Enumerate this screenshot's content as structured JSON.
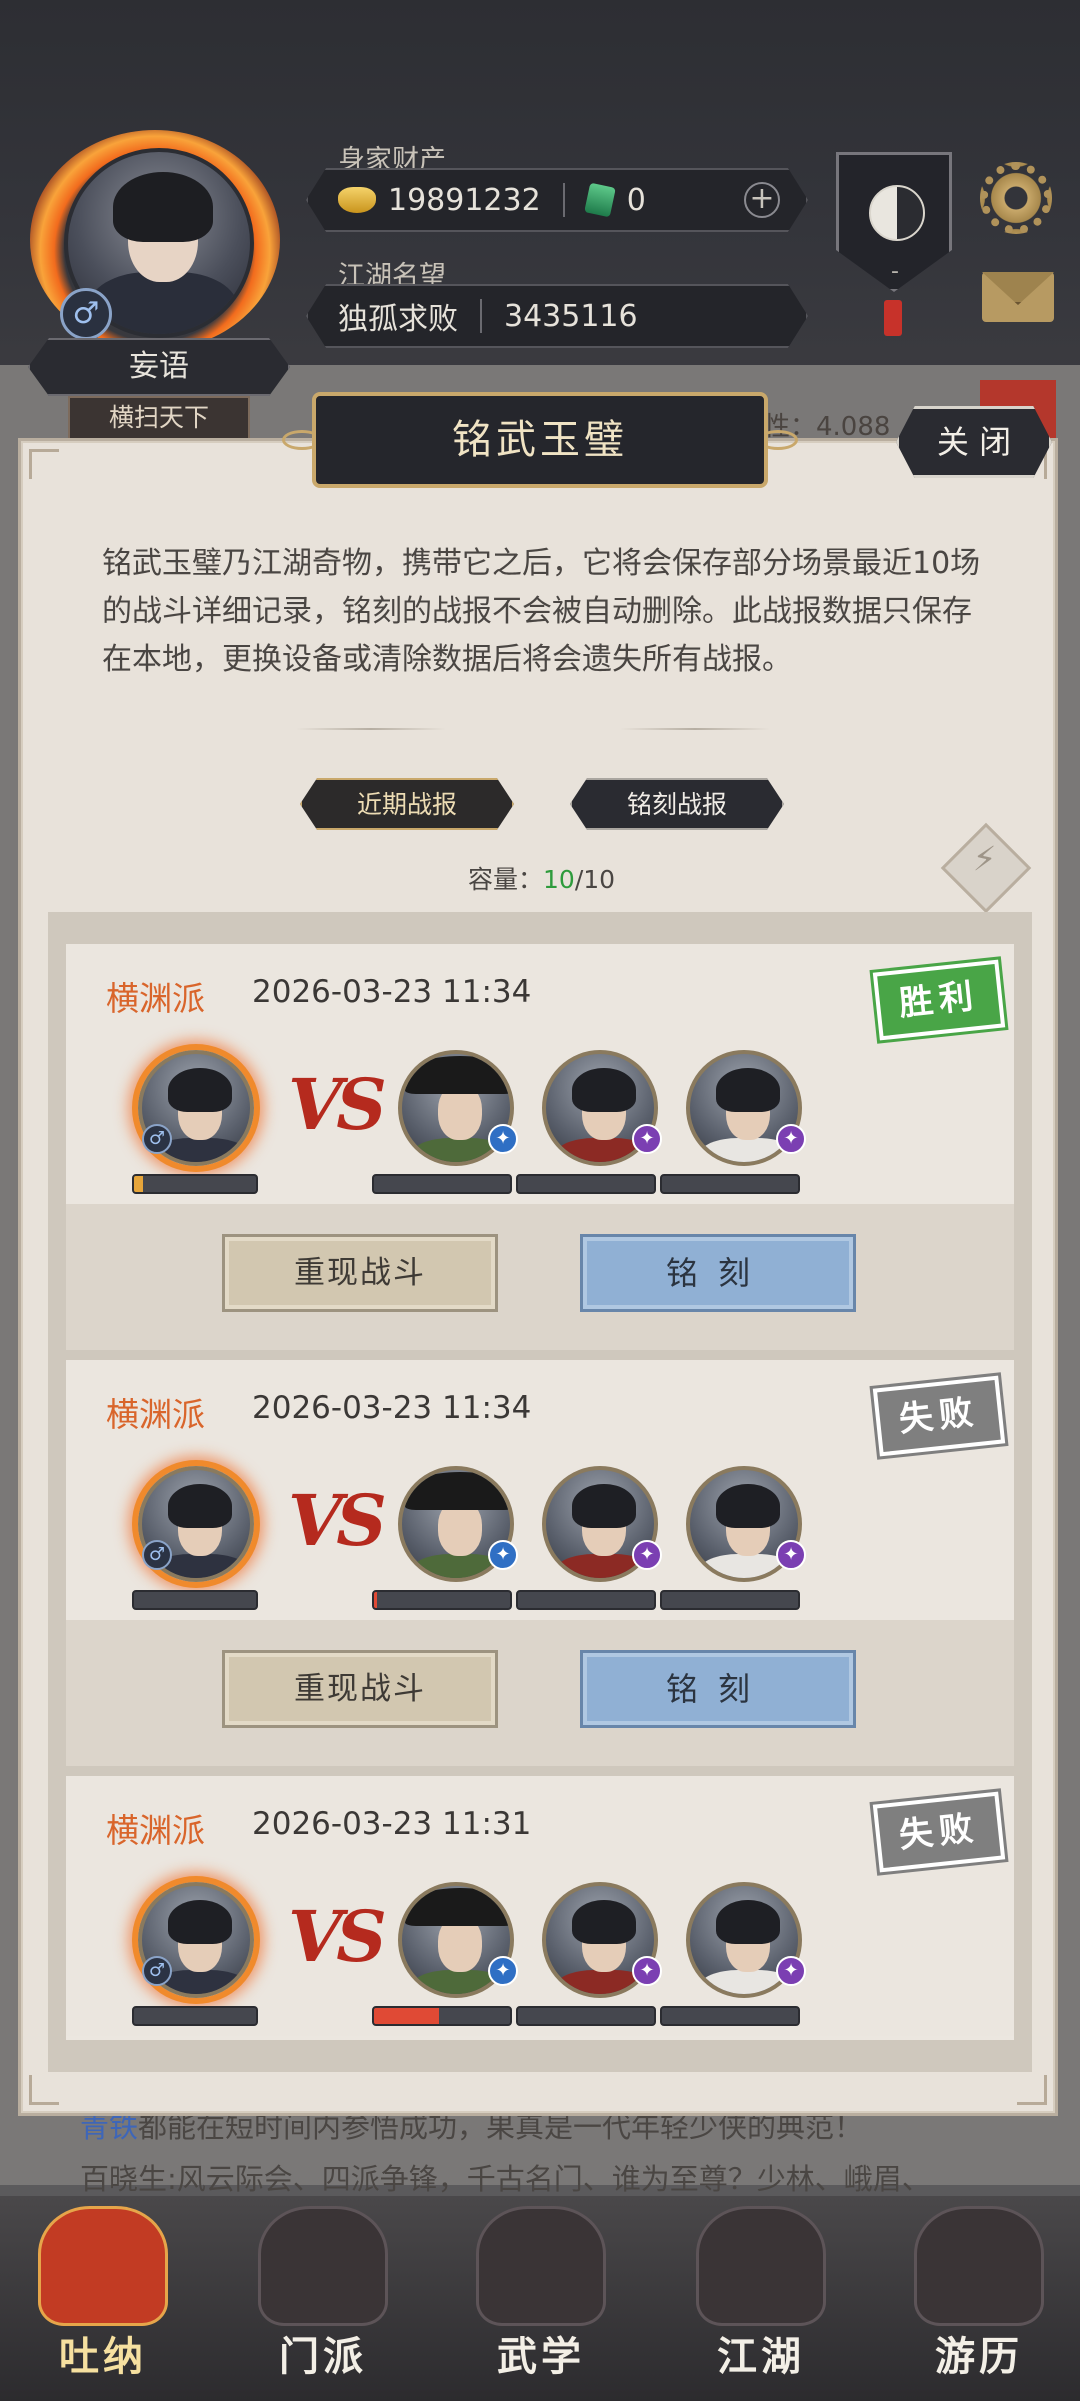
{
  "header": {
    "player_name": "妄语",
    "player_title": "横扫天下",
    "gender_symbol": "♂",
    "wealth_label": "身家财产",
    "gold": "19891232",
    "jade": "0",
    "plus": "+",
    "reputation_label": "江湖名望",
    "rank_name": "独孤求败",
    "reputation_value": "3435116",
    "taiji_dash": "-",
    "attr_text": "性：4.088"
  },
  "modal": {
    "title": "铭武玉璧",
    "close_label": "关 闭",
    "description": "铭武玉璧乃江湖奇物，携带它之后，它将会保存部分场景最近10场的战斗详细记录，铭刻的战报不会被自动删除。此战报数据只保存在本地，更换设备或清除数据后将会遗失所有战报。",
    "tabs": [
      {
        "label": "近期战报"
      },
      {
        "label": "铭刻战报"
      }
    ],
    "capacity_label": "容量：",
    "capacity_used": "10",
    "capacity_total": "/10",
    "refresh_glyph": "⚡"
  },
  "records": [
    {
      "sect": "横渊派",
      "time": "2026-03-23 11:34",
      "result": "胜利",
      "vs": "VS",
      "player_hp": 0.07,
      "enemy_hp": [
        0,
        0,
        0
      ],
      "replay_label": "重现战斗",
      "engrave_label": "铭刻"
    },
    {
      "sect": "横渊派",
      "time": "2026-03-23 11:34",
      "result": "失败",
      "vs": "VS",
      "player_hp": 0,
      "enemy_hp": [
        0.02,
        0,
        0
      ],
      "replay_label": "重现战斗",
      "engrave_label": "铭刻"
    },
    {
      "sect": "横渊派",
      "time": "2026-03-23 11:31",
      "result": "失败",
      "vs": "VS",
      "player_hp": 0,
      "enemy_hp": [
        0.48,
        0,
        0
      ],
      "replay_label": "重现战斗",
      "engrave_label": "铭刻"
    }
  ],
  "chat": {
    "line1_prefix": "青铁",
    "line1_text": "都能在短时间内参悟成功，果真是一代年轻少侠的典范！",
    "line2": "百晓生:风云际会、四派争锋，千古名门、谁为至尊？少林、峨眉、"
  },
  "nav": [
    {
      "label": "吐纳",
      "icon": "gourd-icon"
    },
    {
      "label": "门派",
      "icon": "banner-icon"
    },
    {
      "label": "武学",
      "icon": "book-icon"
    },
    {
      "label": "江湖",
      "icon": "hat-icon"
    },
    {
      "label": "游历",
      "icon": "horse-icon"
    }
  ],
  "colors": {
    "win": "#49a547",
    "lose": "#7f7f7f",
    "sect": "#d9652b",
    "engrave_button": "#90b0d4"
  }
}
